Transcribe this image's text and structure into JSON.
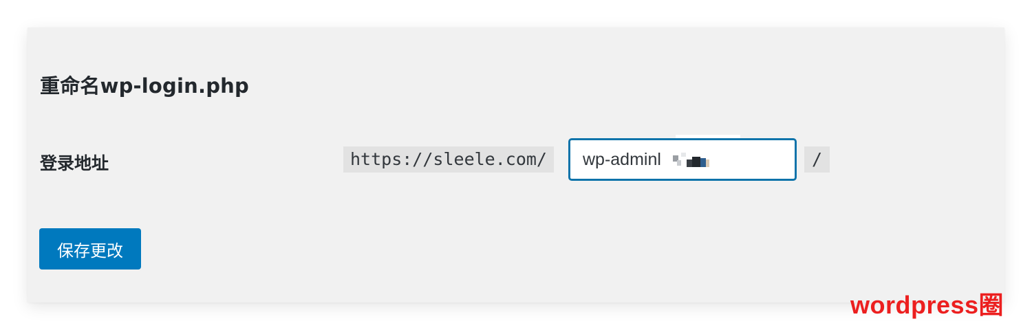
{
  "settings": {
    "title": "重命名wp-login.php",
    "login_url_label": "登录地址",
    "url_prefix": "https://sleele.com/",
    "slug_value": "wp-adminl",
    "url_suffix": "/",
    "save_label": "保存更改"
  },
  "watermark": {
    "text": "wordpress圈"
  },
  "colors": {
    "panel_bg": "#f1f1f1",
    "input_focus_border": "#0e73aa",
    "button_primary": "#0079be",
    "watermark": "#ec1f1f"
  }
}
